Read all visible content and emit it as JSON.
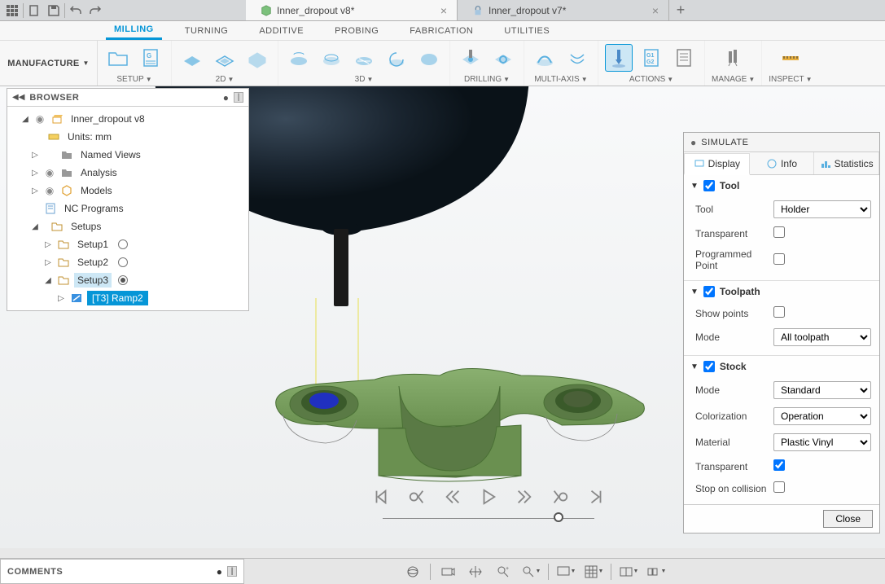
{
  "topbar": {
    "file_tabs": [
      {
        "icon": "cube",
        "label": "Inner_dropout v8*",
        "active": true
      },
      {
        "icon": "lock",
        "label": "Inner_dropout v7*",
        "active": false
      }
    ]
  },
  "ribbon": {
    "workspace": "MANUFACTURE",
    "tabs": [
      "MILLING",
      "TURNING",
      "ADDITIVE",
      "PROBING",
      "FABRICATION",
      "UTILITIES"
    ],
    "active_tab": "MILLING",
    "groups": [
      {
        "label": "SETUP",
        "caret": true,
        "icons": [
          "folder-open",
          "gcode-sheet"
        ]
      },
      {
        "label": "2D",
        "caret": true,
        "icons": [
          "face-mill",
          "contour-2d",
          "pocket-2d"
        ]
      },
      {
        "label": "3D",
        "caret": true,
        "icons": [
          "adaptive-3d",
          "parallel-3d",
          "scallop-3d",
          "spiral-3d",
          "radial-3d"
        ]
      },
      {
        "label": "DRILLING",
        "caret": true,
        "icons": [
          "drill-basic",
          "drill-bore"
        ]
      },
      {
        "label": "MULTI-AXIS",
        "caret": true,
        "icons": [
          "swarf",
          "multi-flow"
        ]
      },
      {
        "label": "ACTIONS",
        "caret": true,
        "icons": [
          "simulate",
          "post-process",
          "setup-sheet"
        ]
      },
      {
        "label": "MANAGE",
        "caret": true,
        "icons": [
          "tool-library"
        ]
      },
      {
        "label": "INSPECT",
        "caret": true,
        "icons": [
          "measure"
        ]
      }
    ]
  },
  "browser": {
    "title": "BROWSER",
    "root": {
      "label": "Inner_dropout v8",
      "expanded": true
    },
    "units": "Units: mm",
    "nodes": [
      {
        "label": "Named Views",
        "icon": "folder",
        "tri": "right",
        "eye": false
      },
      {
        "label": "Analysis",
        "icon": "folder",
        "tri": "right",
        "eye": false
      },
      {
        "label": "Models",
        "icon": "models",
        "tri": "right",
        "eye": true
      },
      {
        "label": "NC Programs",
        "icon": "nc",
        "tri": "none",
        "eye": false
      },
      {
        "label": "Setups",
        "icon": "setup",
        "tri": "down",
        "eye": false
      }
    ],
    "setups": [
      {
        "label": "Setup1",
        "radio": "empty"
      },
      {
        "label": "Setup2",
        "radio": "empty"
      },
      {
        "label": "Setup3",
        "radio": "filled",
        "selected": true
      }
    ],
    "setup3_children": [
      {
        "label": "[T3] Ramp2",
        "icon": "ramp",
        "selected": true
      }
    ]
  },
  "simulate": {
    "title": "SIMULATE",
    "tabs": [
      "Display",
      "Info",
      "Statistics"
    ],
    "active_tab": "Display",
    "sections": {
      "tool": {
        "title": "Tool",
        "checked": true,
        "rows": [
          {
            "label": "Tool",
            "type": "select",
            "value": "Holder"
          },
          {
            "label": "Transparent",
            "type": "check",
            "value": false
          },
          {
            "label": "Programmed Point",
            "type": "check",
            "value": false
          }
        ]
      },
      "toolpath": {
        "title": "Toolpath",
        "checked": true,
        "rows": [
          {
            "label": "Show points",
            "type": "check",
            "value": false
          },
          {
            "label": "Mode",
            "type": "select",
            "value": "All toolpath"
          }
        ]
      },
      "stock": {
        "title": "Stock",
        "checked": true,
        "rows": [
          {
            "label": "Mode",
            "type": "select",
            "value": "Standard"
          },
          {
            "label": "Colorization",
            "type": "select",
            "value": "Operation"
          },
          {
            "label": "Material",
            "type": "select",
            "value": "Plastic Vinyl"
          },
          {
            "label": "Transparent",
            "type": "check",
            "value": true
          },
          {
            "label": "Stop on collision",
            "type": "check",
            "value": false
          }
        ]
      }
    },
    "close_label": "Close"
  },
  "playback": {
    "controls": [
      "skip-start",
      "rewind-loop",
      "step-back",
      "play",
      "step-forward",
      "fast-forward-loop",
      "skip-end"
    ]
  },
  "footer": {
    "comments_title": "COMMENTS",
    "view_tools": [
      "orbit",
      "look-at",
      "pan",
      "zoom-fit",
      "zoom",
      "display-settings",
      "grid-settings",
      "viewport-settings",
      "multi-view"
    ]
  }
}
